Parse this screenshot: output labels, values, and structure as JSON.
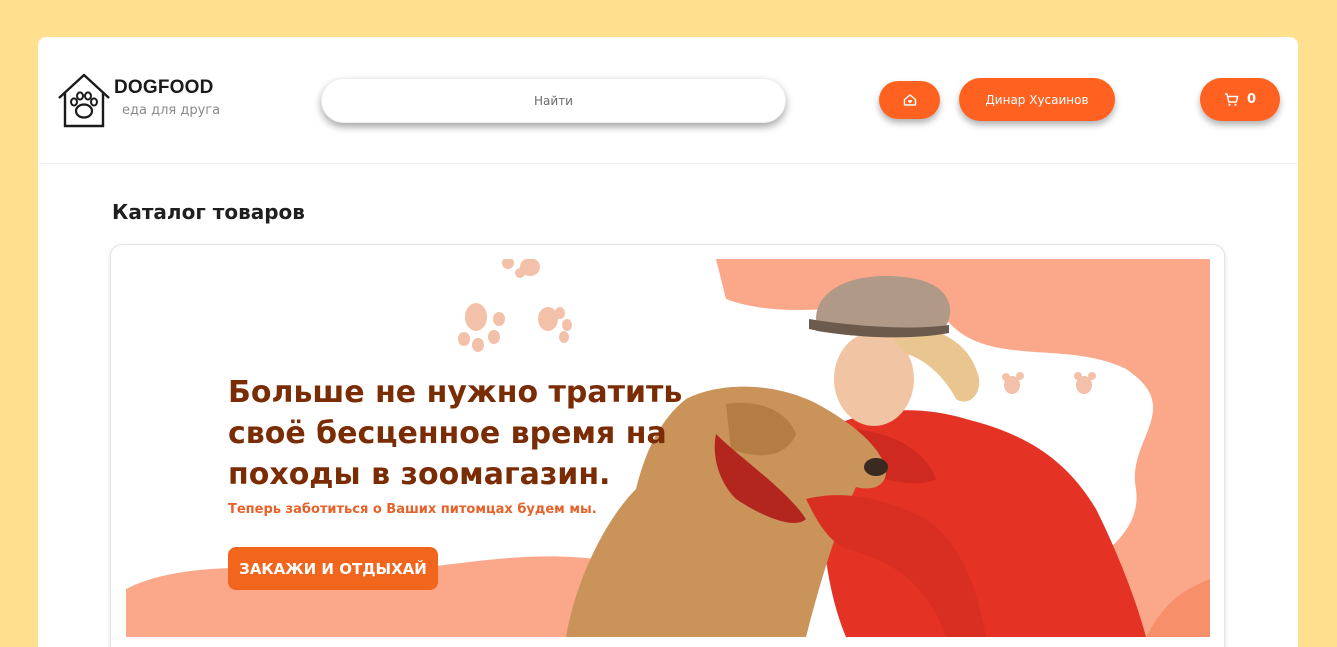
{
  "brand": {
    "name": "DOGFOOD",
    "tagline": "еда для друга",
    "accent_color": "#ff6120",
    "background_color": "#ffe08e"
  },
  "header": {
    "search": {
      "placeholder": "Найти",
      "icon": "none"
    },
    "home_button": {
      "icon": "house-icon"
    },
    "user_button": {
      "label": "Динар Хусаинов"
    },
    "cart_button": {
      "icon": "cart-icon",
      "count": "0"
    }
  },
  "main": {
    "title": "Каталог товаров",
    "banner": {
      "headline_line1": "Больше не нужно тратить",
      "headline_line2": "своё бесценное время на",
      "headline_line3": "походы в зоомагазин.",
      "subtext": "Теперь заботиться о Ваших питомцах будем мы.",
      "cta_label": "ЗАКАЖИ И ОТДЫХАЙ",
      "headline_color": "#7a2c05",
      "cta_color": "#f2651d"
    }
  }
}
